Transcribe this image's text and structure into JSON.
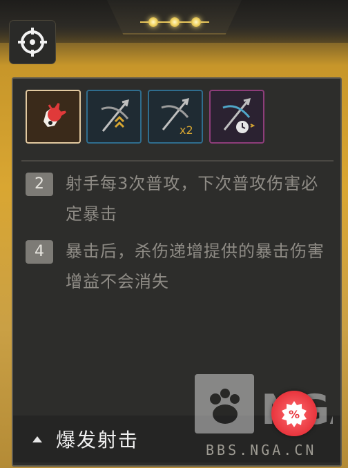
{
  "header": {
    "dots_count": 3
  },
  "skills": [
    {
      "name": "skill-crit-burst",
      "state": "selected"
    },
    {
      "name": "skill-arrows-up",
      "state": "normal"
    },
    {
      "name": "skill-arrows-x2",
      "state": "normal"
    },
    {
      "name": "skill-arrows-clock",
      "state": "locked-style"
    }
  ],
  "effects": [
    {
      "level": "2",
      "text": "射手每3次普攻，下次普攻伤害必定暴击"
    },
    {
      "level": "4",
      "text": "暴击后，杀伤递增提供的暴击伤害增益不会消失"
    }
  ],
  "footer": {
    "title": "爆发射击",
    "badge_symbol": "%"
  },
  "watermark": {
    "text": "BBS.NGA.CN",
    "logo_text": "NGA"
  },
  "colors": {
    "gold": "#d9a632",
    "panel": "#2d2d2b",
    "badge_red": "#e8353d",
    "selected_border": "#e2c9a0",
    "blue_border": "#2f6d8e",
    "purple_border": "#8e3d7a"
  },
  "icons": [
    "target-icon",
    "skill-burst-icon",
    "bow-arrows-icon",
    "bow-x2-icon",
    "bow-clock-icon",
    "percent-badge-icon",
    "caret-up-icon"
  ]
}
